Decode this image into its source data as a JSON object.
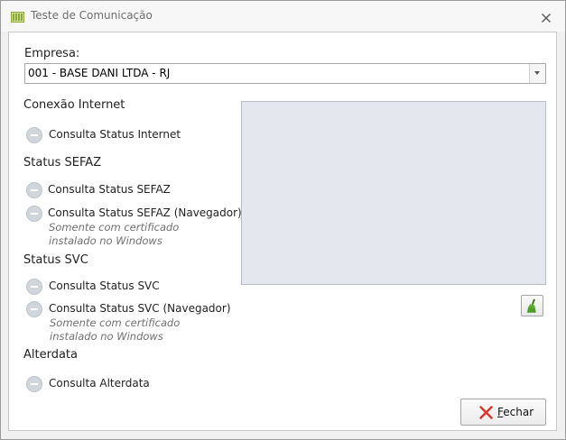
{
  "window": {
    "title": "Teste de Comunicação"
  },
  "empresa": {
    "label": "Empresa:",
    "selected": "001 - BASE DANI LTDA - RJ"
  },
  "sections": {
    "internet": {
      "title": "Conexão Internet",
      "items": [
        {
          "label": "Consulta Status Internet"
        }
      ]
    },
    "sefaz": {
      "title": "Status SEFAZ",
      "items": [
        {
          "label": "Consulta Status SEFAZ"
        },
        {
          "label": "Consulta Status SEFAZ (Navegador)",
          "note": "Somente com certificado instalado no Windows"
        }
      ]
    },
    "svc": {
      "title": "Status SVC",
      "items": [
        {
          "label": "Consulta Status SVC"
        },
        {
          "label": "Consulta Status SVC (Navegador)",
          "note": "Somente com certificado instalado no Windows"
        }
      ]
    },
    "alterdata": {
      "title": "Alterdata",
      "items": [
        {
          "label": "Consulta Alterdata"
        }
      ]
    }
  },
  "buttons": {
    "close_accel": "F",
    "close_rest": "echar"
  },
  "icons": {
    "app": "app-window-icon",
    "close": "close-x-icon",
    "clear": "broom-icon",
    "fechar": "red-x-icon"
  },
  "colors": {
    "status_dot": "#cfd6dc",
    "log_bg": "#e4e8ee",
    "broom_green": "#4f9a2e",
    "close_red": "#d9342b"
  }
}
